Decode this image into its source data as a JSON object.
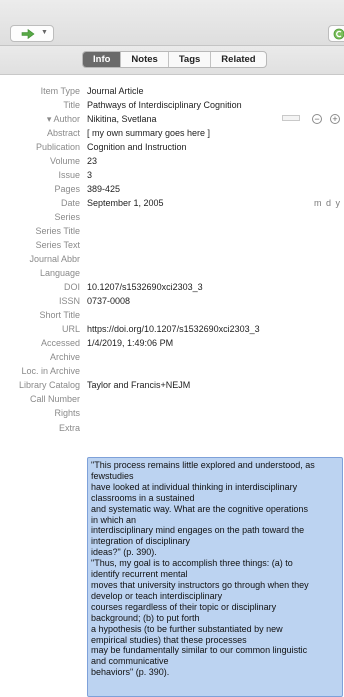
{
  "toolbar": {
    "left_icon": "arrow-right-icon",
    "right_icon": "locate-icon"
  },
  "tabs": [
    {
      "label": "Info",
      "active": true
    },
    {
      "label": "Notes",
      "active": false
    },
    {
      "label": "Tags",
      "active": false
    },
    {
      "label": "Related",
      "active": false
    }
  ],
  "fields": {
    "item_type": {
      "label": "Item Type",
      "value": "Journal Article"
    },
    "title": {
      "label": "Title",
      "value": "Pathways of Interdisciplinary Cognition"
    },
    "author": {
      "label": "Author",
      "toggle": "▾",
      "value": "Nikitina, Svetlana"
    },
    "abstract": {
      "label": "Abstract",
      "value": "[ my own summary goes here ]"
    },
    "publication": {
      "label": "Publication",
      "value": "Cognition and Instruction"
    },
    "volume": {
      "label": "Volume",
      "value": "23"
    },
    "issue": {
      "label": "Issue",
      "value": "3"
    },
    "pages": {
      "label": "Pages",
      "value": "389-425"
    },
    "date": {
      "label": "Date",
      "value": "September 1, 2005",
      "format": "m d y"
    },
    "series": {
      "label": "Series",
      "value": ""
    },
    "series_title": {
      "label": "Series Title",
      "value": ""
    },
    "series_text": {
      "label": "Series Text",
      "value": ""
    },
    "journal_abbr": {
      "label": "Journal Abbr",
      "value": ""
    },
    "language": {
      "label": "Language",
      "value": ""
    },
    "doi": {
      "label": "DOI",
      "value": "10.1207/s1532690xci2303_3"
    },
    "issn": {
      "label": "ISSN",
      "value": "0737-0008"
    },
    "short_title": {
      "label": "Short Title",
      "value": ""
    },
    "url": {
      "label": "URL",
      "value": "https://doi.org/10.1207/s1532690xci2303_3"
    },
    "accessed": {
      "label": "Accessed",
      "value": "1/4/2019, 1:49:06 PM"
    },
    "archive": {
      "label": "Archive",
      "value": ""
    },
    "loc_in_archive": {
      "label": "Loc. in Archive",
      "value": ""
    },
    "library_catalog": {
      "label": "Library Catalog",
      "value": "Taylor and Francis+NEJM"
    },
    "call_number": {
      "label": "Call Number",
      "value": ""
    },
    "rights": {
      "label": "Rights",
      "value": ""
    },
    "extra": {
      "label": "Extra"
    }
  },
  "author_controls": {
    "minus": "−",
    "plus": "+"
  },
  "extra_lines": [
    "\"This process remains little explored and understood, as",
    "fewstudies",
    "have looked at individual thinking in interdisciplinary",
    "classrooms in a sustained",
    "and systematic way. What are the cognitive operations",
    "in which an",
    "interdisciplinary mind engages on the path toward the",
    "integration of disciplinary",
    "ideas?\" (p. 390).",
    "\"Thus, my goal is to accomplish three things: (a) to",
    "identify recurrent mental",
    "moves that university instructors go through when they",
    "develop or teach interdisciplinary",
    "courses regardless of their topic or disciplinary",
    "background; (b) to put forth",
    "a hypothesis (to be further substantiated by new",
    "empirical studies) that these processes",
    "may be fundamentally similar to our common linguistic",
    "and communicative",
    "behaviors\" (p. 390)."
  ]
}
